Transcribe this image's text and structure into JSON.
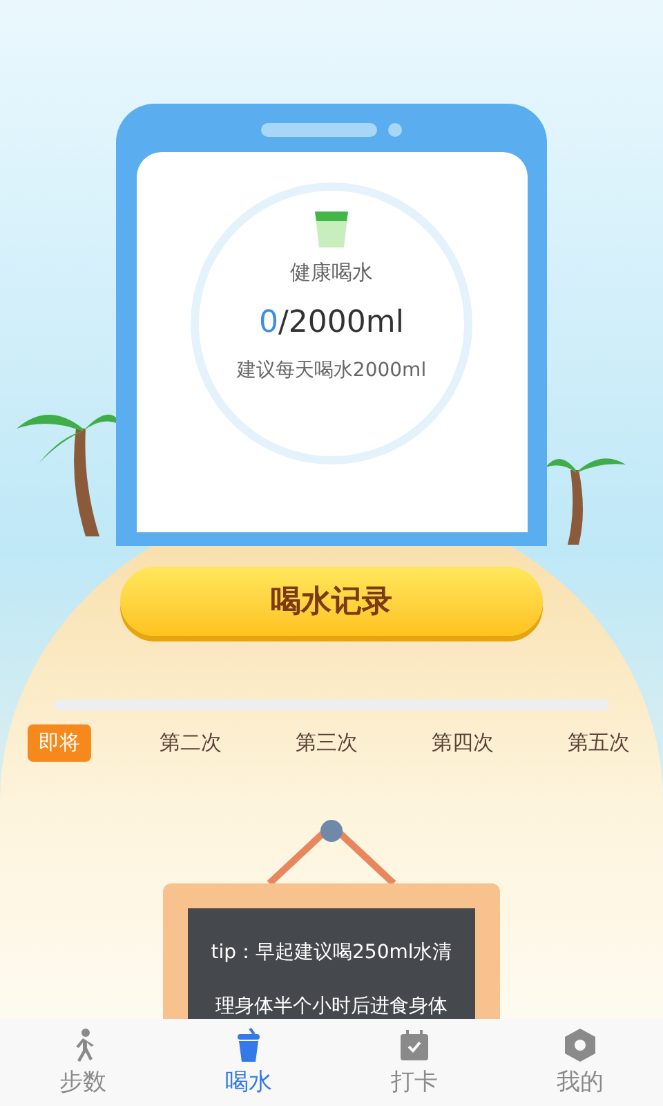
{
  "card": {
    "title": "健康喝水",
    "current": "0",
    "goal": "/2000ml",
    "hint": "建议每天喝水2000ml"
  },
  "record_button": "喝水记录",
  "progress": {
    "level": 0
  },
  "steps": [
    {
      "label": "即将",
      "selected": true
    },
    {
      "label": "第二次",
      "selected": false
    },
    {
      "label": "第三次",
      "selected": false
    },
    {
      "label": "第四次",
      "selected": false
    },
    {
      "label": "第五次",
      "selected": false
    }
  ],
  "tip_lines": [
    "tip：早起建议喝250ml水清",
    "理身体半个小时后进食身体"
  ],
  "tabs": [
    {
      "label": "步数",
      "kind": "walk",
      "selected": false
    },
    {
      "label": "喝水",
      "kind": "cup",
      "selected": true
    },
    {
      "label": "打卡",
      "kind": "calendar",
      "selected": false
    },
    {
      "label": "我的",
      "kind": "hexagon",
      "selected": false
    }
  ]
}
